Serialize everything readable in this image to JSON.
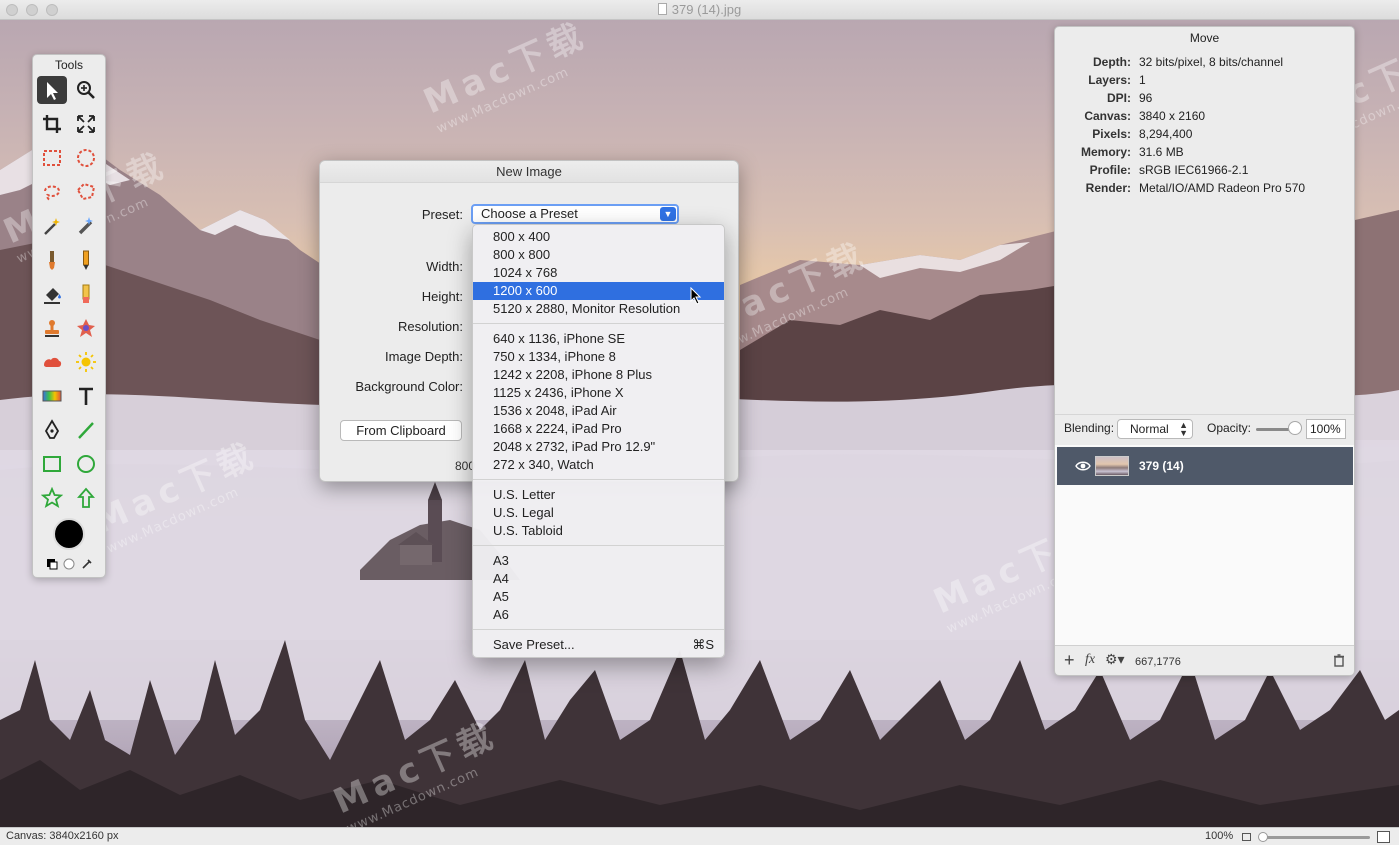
{
  "window": {
    "title": "379 (14).jpg"
  },
  "tools": {
    "title": "Tools",
    "items": [
      "move-tool",
      "zoom-tool",
      "crop-tool",
      "resize-tool",
      "rect-marquee-tool",
      "ellipse-marquee-tool",
      "lasso-tool",
      "polygon-lasso-tool",
      "magic-wand-tool",
      "magic-eraser-tool",
      "brush-tool",
      "pencil-tool",
      "fill-tool",
      "eraser-tool",
      "clone-stamp-tool",
      "retouch-tool",
      "smudge-tool",
      "dodge-burn-tool",
      "gradient-tool",
      "text-tool",
      "pen-tool",
      "line-tool",
      "rectangle-shape-tool",
      "ellipse-shape-tool",
      "star-shape-tool",
      "arrow-shape-tool"
    ]
  },
  "inspector": {
    "title": "Move",
    "info": [
      {
        "label": "Depth:",
        "value": "32 bits/pixel, 8 bits/channel"
      },
      {
        "label": "Layers:",
        "value": "1"
      },
      {
        "label": "DPI:",
        "value": "96"
      },
      {
        "label": "Canvas:",
        "value": "3840 x 2160"
      },
      {
        "label": "Pixels:",
        "value": "8,294,400"
      },
      {
        "label": "Memory:",
        "value": "31.6 MB"
      },
      {
        "label": "Profile:",
        "value": "sRGB IEC61966-2.1"
      },
      {
        "label": "Render:",
        "value": "Metal/IO/AMD Radeon Pro 570"
      }
    ],
    "blending_label": "Blending:",
    "blending_value": "Normal",
    "opacity_label": "Opacity:",
    "opacity_value": "100%",
    "opacity_level": 1.0,
    "layer_name": "379 (14)",
    "fx_label": "fx",
    "coords": "667,1776"
  },
  "dialog": {
    "title": "New Image",
    "preset_label": "Preset:",
    "preset_value": "Choose a Preset",
    "width_label": "Width:",
    "height_label": "Height:",
    "resolution_label": "Resolution:",
    "depth_label": "Image Depth:",
    "background_label": "Background Color:",
    "clipboard_button": "From Clipboard",
    "footer_fragment": "800"
  },
  "menu": {
    "groups": [
      [
        "800 x 400",
        "800 x 800",
        "1024 x 768",
        "1200 x 600",
        "5120 x 2880, Monitor Resolution"
      ],
      [
        "640 x 1136, iPhone SE",
        "750 x 1334, iPhone 8",
        "1242 x 2208, iPhone 8 Plus",
        "1125 x 2436, iPhone X",
        "1536 x 2048, iPad Air",
        "1668 x 2224, iPad Pro",
        "2048 x 2732, iPad Pro 12.9\"",
        "272 x 340,  Watch"
      ],
      [
        "U.S. Letter",
        "U.S. Legal",
        "U.S. Tabloid"
      ],
      [
        "A3",
        "A4",
        "A5",
        "A6"
      ]
    ],
    "selected": "1200 x 600",
    "save_label": "Save Preset...",
    "save_shortcut": "⌘S"
  },
  "status": {
    "canvas_info": "Canvas: 3840x2160 px",
    "zoom": "100%"
  },
  "watermark": {
    "brand": "Mac下载",
    "site": "www.Macdown.com"
  },
  "colors": {
    "accent": "#2f6fe0",
    "layer_selected": "#4f5969",
    "foreground": "#000000"
  }
}
